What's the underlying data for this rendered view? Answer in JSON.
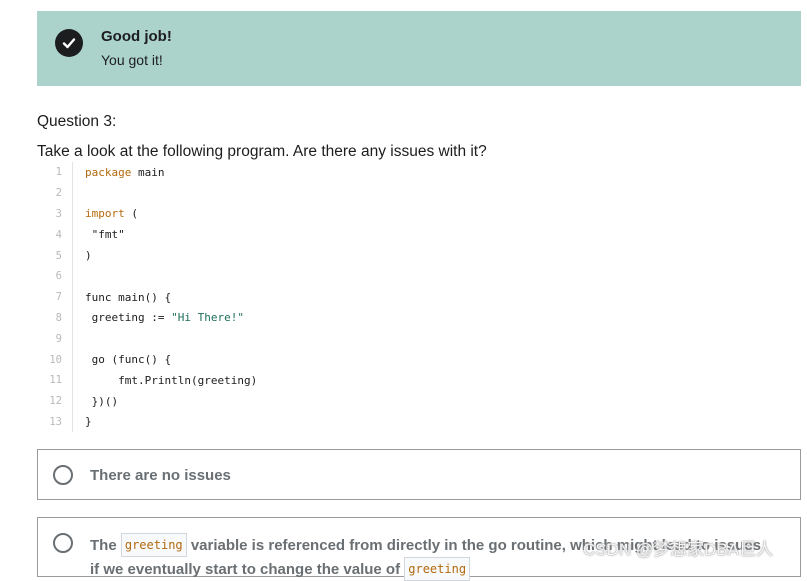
{
  "banner": {
    "title": "Good job!",
    "subtitle": "You got it!",
    "bg_color": "#acd2cc",
    "icon": "check-circle-icon"
  },
  "question": {
    "number_label": "Question 3:",
    "prompt": "Take a look at the following program.  Are there any issues with it?"
  },
  "code": {
    "line_numbers": [
      "1",
      "2",
      "3",
      "4",
      "5",
      "6",
      "7",
      "8",
      "9",
      "10",
      "11",
      "12",
      "13"
    ],
    "lines": [
      "package main",
      "",
      "import (",
      " \"fmt\"",
      ")",
      "",
      "func main() {",
      " greeting := \"Hi There!\"",
      "",
      " go (func() {",
      "     fmt.Println(greeting)",
      " })()",
      "}"
    ]
  },
  "options": [
    {
      "text": "There are no issues"
    },
    {
      "text_before": "The",
      "code_word": "greeting",
      "text_after": "variable is referenced from directly in the go routine, which might lead to issues",
      "line2_before": "if we eventually start to change the value of",
      "line2_code": "greeting"
    }
  ],
  "watermark": "CSDN @梦想家DBA巨人"
}
